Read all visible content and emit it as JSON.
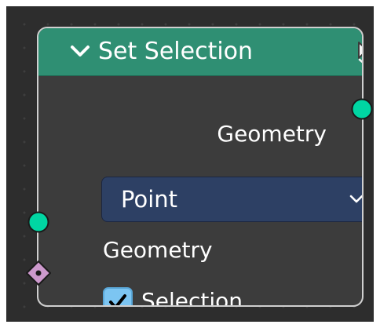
{
  "node": {
    "title": "Set Selection",
    "header_color": "#2f8f73",
    "body_color": "#3c3c3c",
    "border_color": "#cfcfcf",
    "collapse_icon": "chevron-down-icon",
    "cursor_icon": "mouse-cursor-icon"
  },
  "outputs": [
    {
      "label": "Geometry",
      "socket_color": "#00d6a3",
      "socket_shape": "circle"
    }
  ],
  "domain_select": {
    "value": "Point",
    "background": "#2d4064",
    "icon": "chevron-down-icon"
  },
  "inputs": [
    {
      "label": "Geometry",
      "socket_color": "#00d6a3",
      "socket_shape": "circle"
    },
    {
      "label": "Selection",
      "socket_color": "#cc99cc",
      "socket_shape": "diamond",
      "checked": true,
      "checkbox_color": "#7cc5f2"
    }
  ]
}
